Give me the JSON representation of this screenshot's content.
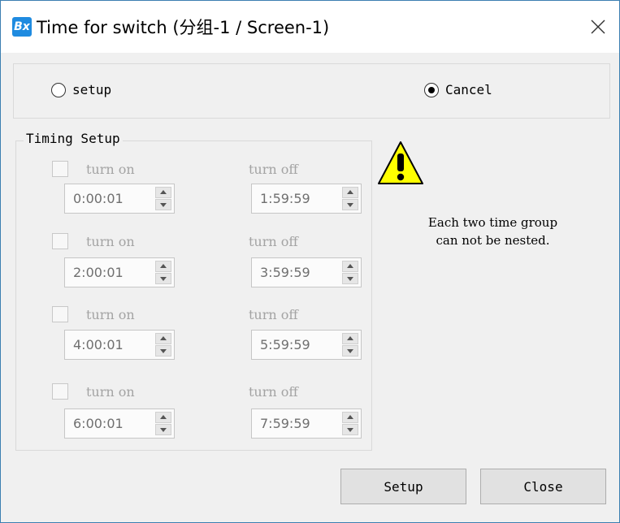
{
  "window": {
    "icon_label": "Bx",
    "title": "Time for switch  (分组-1 / Screen-1)"
  },
  "mode": {
    "options": [
      {
        "label": "setup",
        "selected": false
      },
      {
        "label": "Cancel",
        "selected": true
      }
    ]
  },
  "timing": {
    "title": "Timing Setup",
    "rows": [
      {
        "checked": false,
        "on_label": "turn on",
        "off_label": "turn off",
        "on_value": "0:00:01",
        "off_value": "1:59:59"
      },
      {
        "checked": false,
        "on_label": "turn on",
        "off_label": "turn off",
        "on_value": "2:00:01",
        "off_value": "3:59:59"
      },
      {
        "checked": false,
        "on_label": "turn on",
        "off_label": "turn off",
        "on_value": "4:00:01",
        "off_value": "5:59:59"
      },
      {
        "checked": false,
        "on_label": "turn on",
        "off_label": "turn off",
        "on_value": "6:00:01",
        "off_value": "7:59:59"
      }
    ]
  },
  "warning": {
    "icon": "warning-icon",
    "line1": "Each two time group",
    "line2": "can not be nested."
  },
  "buttons": {
    "setup": "Setup",
    "close": "Close"
  },
  "colors": {
    "accent": "#3c7fb1",
    "disabled_text": "#a3a3a3",
    "warning_yellow": "#ffff00"
  }
}
